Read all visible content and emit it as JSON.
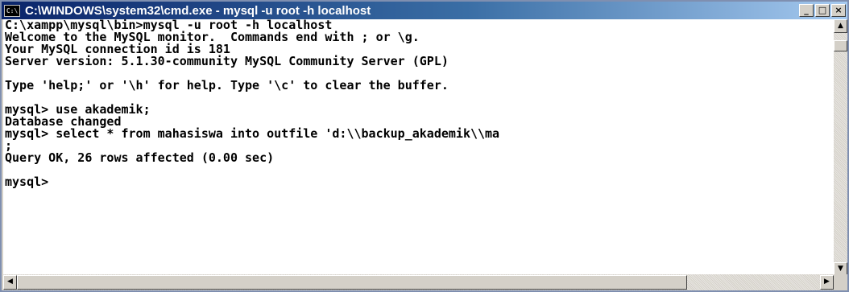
{
  "window": {
    "title": "C:\\WINDOWS\\system32\\cmd.exe - mysql -u root -h localhost",
    "icon": "console-icon",
    "icon_text": "C:\\",
    "minimize_label": "_",
    "maximize_label": "□",
    "close_label": "×"
  },
  "console": {
    "lines": [
      "C:\\xampp\\mysql\\bin>mysql -u root -h localhost",
      "Welcome to the MySQL monitor.  Commands end with ; or \\g.",
      "Your MySQL connection id is 181",
      "Server version: 5.1.30-community MySQL Community Server (GPL)",
      "",
      "Type 'help;' or '\\h' for help. Type '\\c' to clear the buffer.",
      "",
      "mysql> use akademik;",
      "Database changed",
      "mysql> select * from mahasiswa into outfile 'd:\\\\backup_akademik\\\\ma",
      ";",
      "Query OK, 26 rows affected (0.00 sec)",
      "",
      "mysql>"
    ]
  },
  "scrollbars": {
    "up_arrow": "▲",
    "down_arrow": "▼",
    "left_arrow": "◀",
    "right_arrow": "▶"
  }
}
